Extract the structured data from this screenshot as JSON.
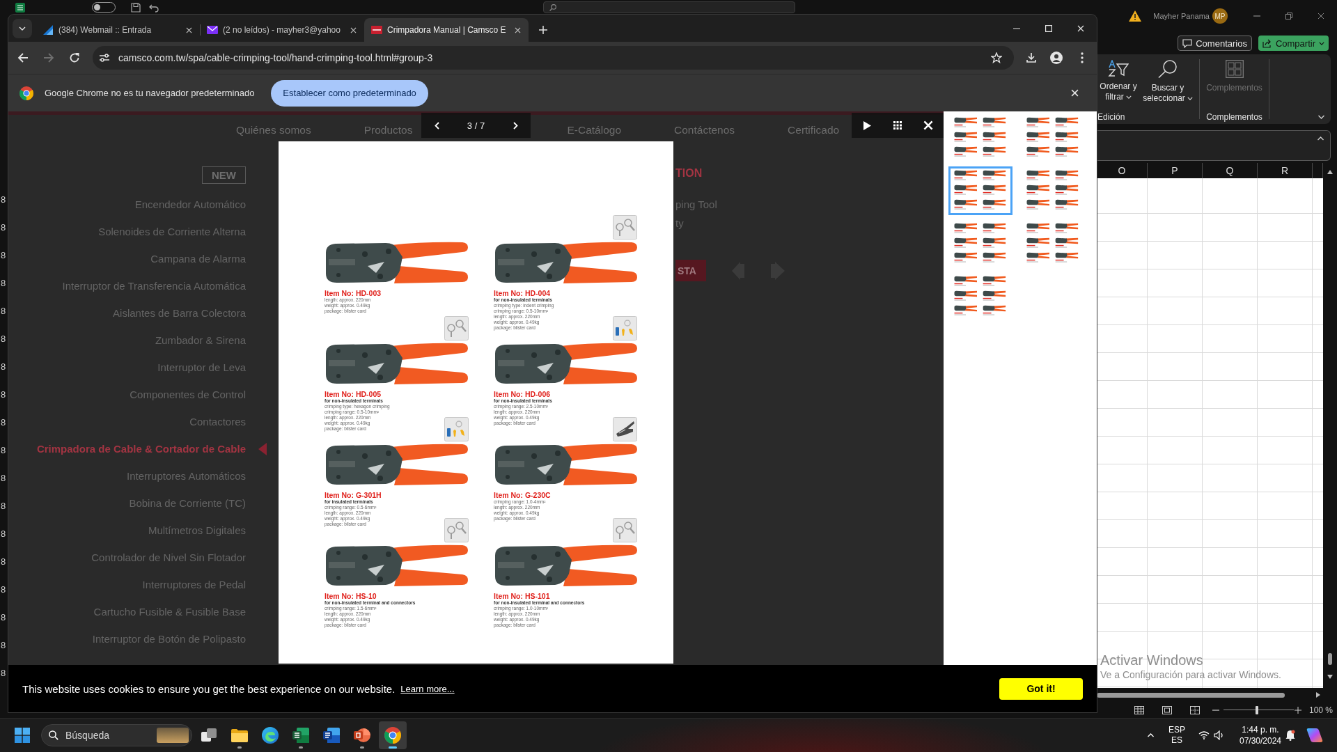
{
  "excel": {
    "title_bar": {
      "autosave": {
        "on": false
      },
      "account_name": "Mayher Panama",
      "avatar_initials": "MP"
    },
    "actions": [
      {
        "label": "Comentarios",
        "kind": "comments"
      },
      {
        "label": "Compartir",
        "kind": "share"
      }
    ],
    "ribbon": {
      "commands": [
        {
          "label": "Ordenar y filtrar",
          "kind": "sort",
          "disabled": false,
          "dropdown": true
        },
        {
          "label": "Buscar y seleccionar",
          "kind": "find",
          "disabled": false,
          "dropdown": true
        },
        {
          "label": "Complementos",
          "kind": "addins",
          "disabled": true,
          "dropdown": false
        }
      ],
      "groups": [
        "Edición",
        "Complementos"
      ]
    },
    "columns": [
      "O",
      "P",
      "Q",
      "R"
    ],
    "row_numbers": [
      "8",
      "8",
      "8",
      "8",
      "8",
      "8",
      "8",
      "8",
      "8",
      "8",
      "8",
      "8",
      "8",
      "8",
      "8",
      "8",
      "8",
      "8"
    ],
    "status_bar": {
      "zoom": {
        "reading": "100 %",
        "level": 0.48
      }
    }
  },
  "browser": {
    "tabs": [
      {
        "title": "(384) Webmail :: Entrada",
        "kind": "webmail",
        "selected": false
      },
      {
        "title": "(2 no leídos) - mayher3@yahoo",
        "kind": "mail",
        "selected": false
      },
      {
        "title": "Crimpadora Manual | Camsco E",
        "kind": "site",
        "selected": true
      }
    ],
    "toolbar": [
      {
        "kind": "back",
        "disabled": false
      },
      {
        "kind": "forward",
        "disabled": true
      },
      {
        "kind": "reload",
        "disabled": false
      }
    ],
    "address": "camsco.com.tw/spa/cable-crimping-tool/hand-crimping-tool.html#group-3",
    "infobar": {
      "message": "Google Chrome no es tu navegador predeterminado",
      "action": "Establecer como predeterminado"
    }
  },
  "website": {
    "nav": [
      "Quiénes somos",
      "Productos",
      "E-Catálogo",
      "Contáctenos",
      "Certificado"
    ],
    "sidebar": {
      "badge": "NEW",
      "categories": [
        {
          "label": "Encendedor Automático",
          "selected": false
        },
        {
          "label": "Solenoides de Corriente Alterna",
          "selected": false
        },
        {
          "label": "Campana de Alarma",
          "selected": false
        },
        {
          "label": "Interruptor de Transferencia Automática",
          "selected": false
        },
        {
          "label": "Aislantes de Barra Colectora",
          "selected": false
        },
        {
          "label": "Zumbador & Sirena",
          "selected": false
        },
        {
          "label": "Interruptor de Leva",
          "selected": false
        },
        {
          "label": "Componentes de Control",
          "selected": false
        },
        {
          "label": "Contactores",
          "selected": false
        },
        {
          "label": "Crimpadora de Cable & Cortador de Cable",
          "selected": true
        },
        {
          "label": "Interruptores Automáticos",
          "selected": false
        },
        {
          "label": "Bobina de Corriente (TC)",
          "selected": false
        },
        {
          "label": "Multímetros Digitales",
          "selected": false
        },
        {
          "label": "Controlador de Nivel Sin Flotador",
          "selected": false
        },
        {
          "label": "Interruptores de Pedal",
          "selected": false
        },
        {
          "label": "Cartucho Fusible & Fusible Base",
          "selected": false
        },
        {
          "label": "Interruptor de Botón de Polipasto",
          "selected": false
        }
      ]
    },
    "content": {
      "heading": "TION",
      "lines": [
        "ping Tool",
        "ty"
      ],
      "button": "STA"
    }
  },
  "lightbox": {
    "counter": "3 / 7",
    "products": [
      {
        "item": "Item No: HD-003",
        "specs": [
          "length: approx. 220mm",
          "weight: approx. 0.49kg",
          "package: blister card"
        ]
      },
      {
        "item": "Item No: HD-004",
        "note": "for non-insulated terminals",
        "specs": [
          "crimping type: indent crimping",
          "crimping range: 0.5-10mm²",
          "length: approx. 220mm",
          "weight: approx. 0.49kg",
          "package: blister card"
        ],
        "tile": {
          "kind": "ring"
        }
      },
      {
        "item": "Item No: HD-005",
        "note": "for non-insulated terminals",
        "specs": [
          "crimping type: hexagon crimping",
          "crimping range: 0.5-10mm²",
          "length: approx. 220mm",
          "weight: approx. 0.49kg",
          "package: blister card"
        ],
        "tile": {
          "kind": "ring"
        }
      },
      {
        "item": "Item No: HD-006",
        "note": "for non-insulated terminals",
        "specs": [
          "crimping range: 2.5-10mm²",
          "length: approx. 220mm",
          "weight: approx. 0.49kg",
          "package: blister card"
        ],
        "tile": {
          "kind": "insulated"
        }
      },
      {
        "item": "Item No: G-301H",
        "note": "for insulated terminals",
        "specs": [
          "crimping range: 0.5-6mm²",
          "length: approx. 220mm",
          "weight: approx. 0.49kg",
          "package: blister card"
        ],
        "tile": {
          "kind": "insulated"
        }
      },
      {
        "item": "Item No: G-230C",
        "specs": [
          "crimping range: 1.0-4mm²",
          "length: approx. 220mm",
          "weight: approx. 0.49kg",
          "package: blister card"
        ],
        "tile": {
          "kind": "blade"
        }
      },
      {
        "item": "Item No: HS-10",
        "note": "for non-insulated terminal and connectors",
        "specs": [
          "crimping range: 1.5-6mm²",
          "length: approx. 220mm",
          "weight: approx. 0.49kg",
          "package: blister card"
        ],
        "tile": {
          "kind": "ring"
        }
      },
      {
        "item": "Item No: HS-101",
        "note": "for non-insulated terminal and connectors",
        "specs": [
          "crimping range: 1.0-10mm²",
          "length: approx. 220mm",
          "weight: approx. 0.49kg",
          "package: blister card"
        ],
        "tile": {
          "kind": "ring"
        }
      }
    ],
    "thumbnails": [
      {
        "selected": false
      },
      {
        "selected": false
      },
      {
        "selected": true
      },
      {
        "selected": false
      },
      {
        "selected": false
      },
      {
        "selected": false
      },
      {
        "selected": false
      }
    ]
  },
  "cookie_banner": {
    "message": "This website uses cookies to ensure you get the best experience on our website.",
    "link": "Learn more...",
    "button": "Got it!"
  },
  "activation_notice": {
    "title": "Activar Windows",
    "subtitle": "Ve a Configuración para activar Windows."
  },
  "taskbar": {
    "search": {
      "placeholder": "Búsqueda"
    },
    "apps": [
      {
        "kind": "task-view",
        "running": false,
        "selected": false
      },
      {
        "kind": "explorer",
        "running": true,
        "selected": false
      },
      {
        "kind": "edge",
        "running": false,
        "selected": false
      },
      {
        "kind": "excel",
        "running": true,
        "selected": false
      },
      {
        "kind": "word",
        "running": false,
        "selected": false
      },
      {
        "kind": "powerpoint",
        "running": true,
        "selected": false
      },
      {
        "kind": "chrome",
        "running": true,
        "selected": true
      }
    ],
    "tray": {
      "language": "ESP",
      "layout": "ES",
      "time": "1:44 p. m.",
      "date": "07/30/2024"
    }
  }
}
